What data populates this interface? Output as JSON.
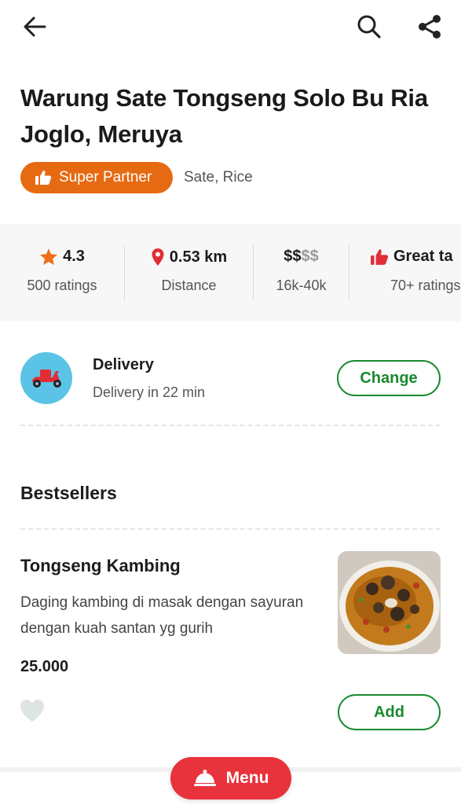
{
  "header": {
    "back_icon": "arrow-left-icon",
    "search_icon": "search-icon",
    "share_icon": "share-icon"
  },
  "restaurant": {
    "name": "Warung Sate Tongseng Solo Bu Ria Joglo, Meruya",
    "badge": "Super Partner",
    "cuisine": "Sate, Rice",
    "brand_color": "#e66a12"
  },
  "stats": [
    {
      "value": "4.3",
      "label": "500 ratings",
      "icon": "star-icon"
    },
    {
      "value": "0.53 km",
      "label": "Distance",
      "icon": "location-pin-icon"
    },
    {
      "value_active": "$$",
      "value_inactive": "$$",
      "label": "16k-40k"
    },
    {
      "value": "Great ta",
      "label": "70+ ratings",
      "icon": "thumbs-up-icon"
    }
  ],
  "delivery": {
    "title": "Delivery",
    "subtitle": "Delivery in 22 min",
    "change_label": "Change"
  },
  "bestsellers": {
    "title": "Bestsellers",
    "items": [
      {
        "name": "Tongseng Kambing",
        "description": "Daging kambing di masak dengan sayuran dengan kuah santan yg gurih",
        "price": "25.000",
        "add_label": "Add"
      }
    ]
  },
  "bottom": {
    "menu_label": "Menu",
    "menu_color": "#e8323c"
  },
  "colors": {
    "accent_green": "#1a8a2e",
    "delivery_bg": "#5bc3e6"
  }
}
